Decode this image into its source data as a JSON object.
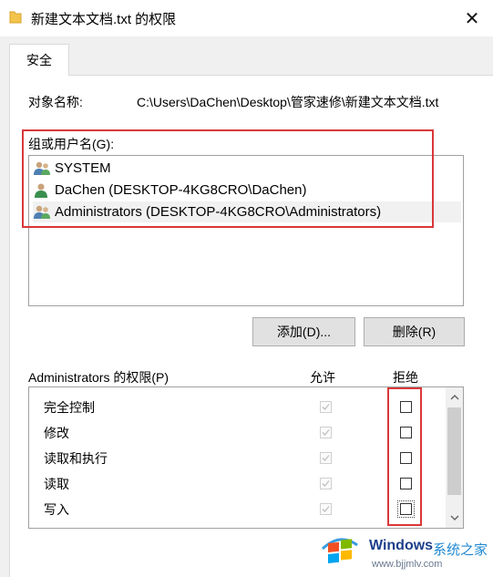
{
  "window": {
    "title": "新建文本文档.txt 的权限",
    "close_label": "✕"
  },
  "tab": {
    "label": "安全"
  },
  "object": {
    "label": "对象名称:",
    "value": "C:\\Users\\DaChen\\Desktop\\管家速修\\新建文本文档.txt"
  },
  "groups": {
    "label": "组或用户名(G):",
    "items": [
      {
        "label": "SYSTEM",
        "icon": "users-group-icon"
      },
      {
        "label": "DaChen (DESKTOP-4KG8CRO\\DaChen)",
        "icon": "user-icon"
      },
      {
        "label": "Administrators (DESKTOP-4KG8CRO\\Administrators)",
        "icon": "users-group-icon"
      }
    ]
  },
  "buttons": {
    "add": "添加(D)...",
    "remove": "删除(R)"
  },
  "permissions": {
    "header": "Administrators 的权限(P)",
    "allow_label": "允许",
    "deny_label": "拒绝",
    "rows": [
      {
        "name": "完全控制",
        "allow": true,
        "deny": false
      },
      {
        "name": "修改",
        "allow": true,
        "deny": false
      },
      {
        "name": "读取和执行",
        "allow": true,
        "deny": false
      },
      {
        "name": "读取",
        "allow": true,
        "deny": false
      },
      {
        "name": "写入",
        "allow": true,
        "deny": false
      }
    ]
  },
  "watermark": {
    "windows": "Windows",
    "site_cn": "系统之家",
    "url": "www.bjjmlv.com"
  },
  "colors": {
    "highlight_red": "#d9383a"
  }
}
